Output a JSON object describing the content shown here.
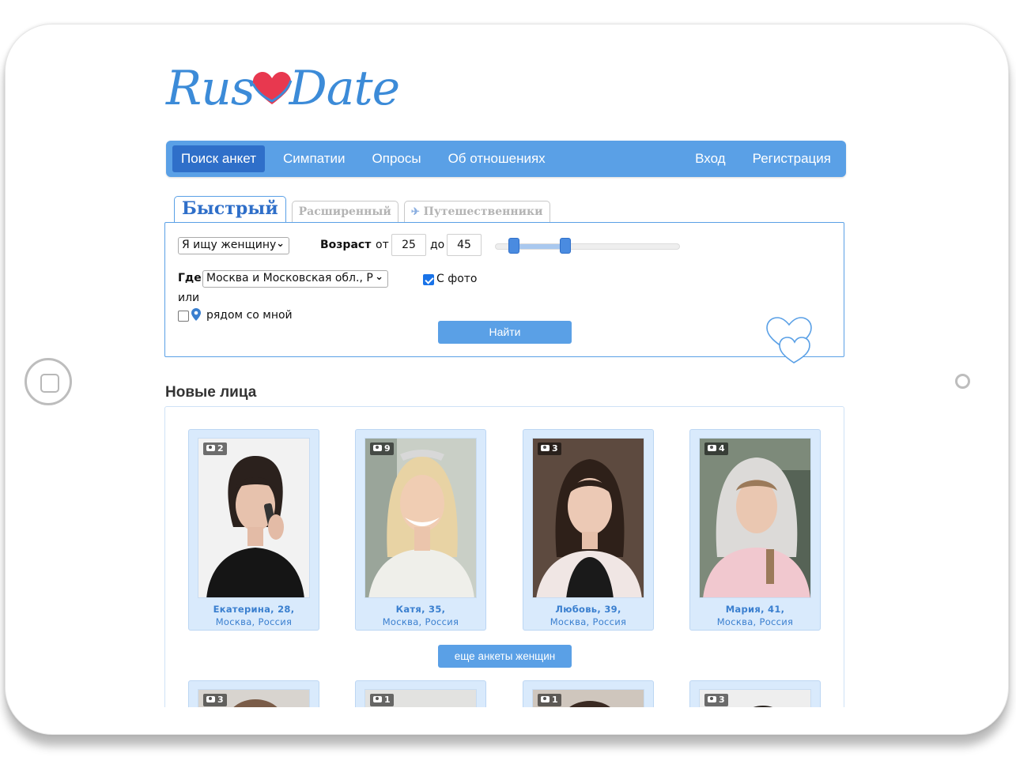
{
  "brand": {
    "logo_part1": "Rus",
    "logo_part2": "Date"
  },
  "nav": {
    "items": [
      "Поиск анкет",
      "Симпатии",
      "Опросы",
      "Об отношениях"
    ],
    "right": [
      "Вход",
      "Регистрация"
    ]
  },
  "tabs": {
    "quick": "Быстрый",
    "extended": "Расширенный",
    "travelers": "Путешественники"
  },
  "search": {
    "looking_for": "Я ищу женщину",
    "age_label": "Возраст",
    "from_label": "от",
    "age_from": "25",
    "to_label": "до",
    "age_to": "45",
    "slider": {
      "min_fraction": 0.1,
      "max_fraction": 0.38
    },
    "where_label": "Где",
    "location": "Москва и Московская обл., Р",
    "or_label": "или",
    "nearby_label": "рядом со мной",
    "nearby_checked": false,
    "with_photo_label": "С фото",
    "with_photo_checked": true,
    "find_button": "Найти"
  },
  "new_faces": {
    "title": "Новые лица",
    "cards": [
      {
        "count": "2",
        "name": "Екатерина, 28,",
        "location": "Москва, Россия"
      },
      {
        "count": "9",
        "name": "Катя, 35,",
        "location": "Москва, Россия"
      },
      {
        "count": "3",
        "name": "Любовь, 39,",
        "location": "Москва, Россия"
      },
      {
        "count": "4",
        "name": "Мария, 41,",
        "location": "Москва, Россия"
      }
    ],
    "more_button": "еще анкеты женщин",
    "second_row_counts": [
      "3",
      "1",
      "1",
      "3"
    ]
  },
  "colors": {
    "accent": "#5aa0e6",
    "accent_dark": "#2f6fc9",
    "heart": "#e8384f",
    "card_bg": "#d9eafc"
  }
}
